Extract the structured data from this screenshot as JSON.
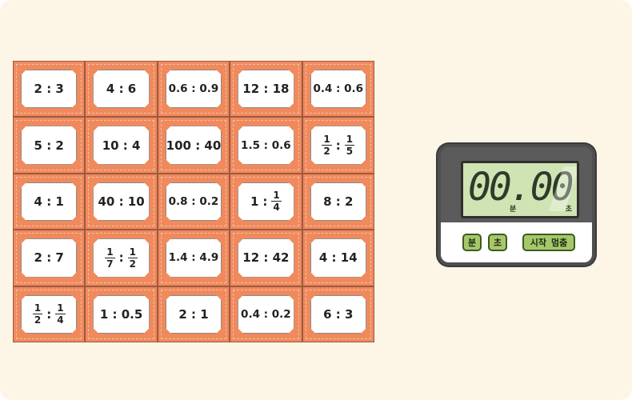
{
  "cards": [
    [
      {
        "t": "text",
        "v": "2 : 3"
      },
      {
        "t": "text",
        "v": "4 : 6"
      },
      {
        "t": "text",
        "v": "0.6 : 0.9"
      },
      {
        "t": "text",
        "v": "12 : 18"
      },
      {
        "t": "text",
        "v": "0.4 : 0.6"
      }
    ],
    [
      {
        "t": "text",
        "v": "5 : 2"
      },
      {
        "t": "text",
        "v": "10 : 4"
      },
      {
        "t": "text",
        "v": "100 : 40"
      },
      {
        "t": "text",
        "v": "1.5 : 0.6"
      },
      {
        "t": "fracfrac",
        "a": [
          "1",
          "2"
        ],
        "b": [
          "1",
          "5"
        ]
      }
    ],
    [
      {
        "t": "text",
        "v": "4 : 1"
      },
      {
        "t": "text",
        "v": "40 : 10"
      },
      {
        "t": "text",
        "v": "0.8 : 0.2"
      },
      {
        "t": "numfrac",
        "a": "1",
        "b": [
          "1",
          "4"
        ]
      },
      {
        "t": "text",
        "v": "8 : 2"
      }
    ],
    [
      {
        "t": "text",
        "v": "2 : 7"
      },
      {
        "t": "fracfrac",
        "a": [
          "1",
          "7"
        ],
        "b": [
          "1",
          "2"
        ]
      },
      {
        "t": "text",
        "v": "1.4 : 4.9"
      },
      {
        "t": "text",
        "v": "12 : 42"
      },
      {
        "t": "text",
        "v": "4 : 14"
      }
    ],
    [
      {
        "t": "fracfrac",
        "a": [
          "1",
          "2"
        ],
        "b": [
          "1",
          "4"
        ]
      },
      {
        "t": "text",
        "v": "1 : 0.5"
      },
      {
        "t": "text",
        "v": "2 : 1"
      },
      {
        "t": "text",
        "v": "0.4 : 0.2"
      },
      {
        "t": "text",
        "v": "6 : 3"
      }
    ]
  ],
  "timer": {
    "display": "00.00",
    "unit_min": "분",
    "unit_sec": "초",
    "btn_min": "분",
    "btn_sec": "초",
    "btn_start": "시작",
    "btn_stop": "멈춤"
  }
}
